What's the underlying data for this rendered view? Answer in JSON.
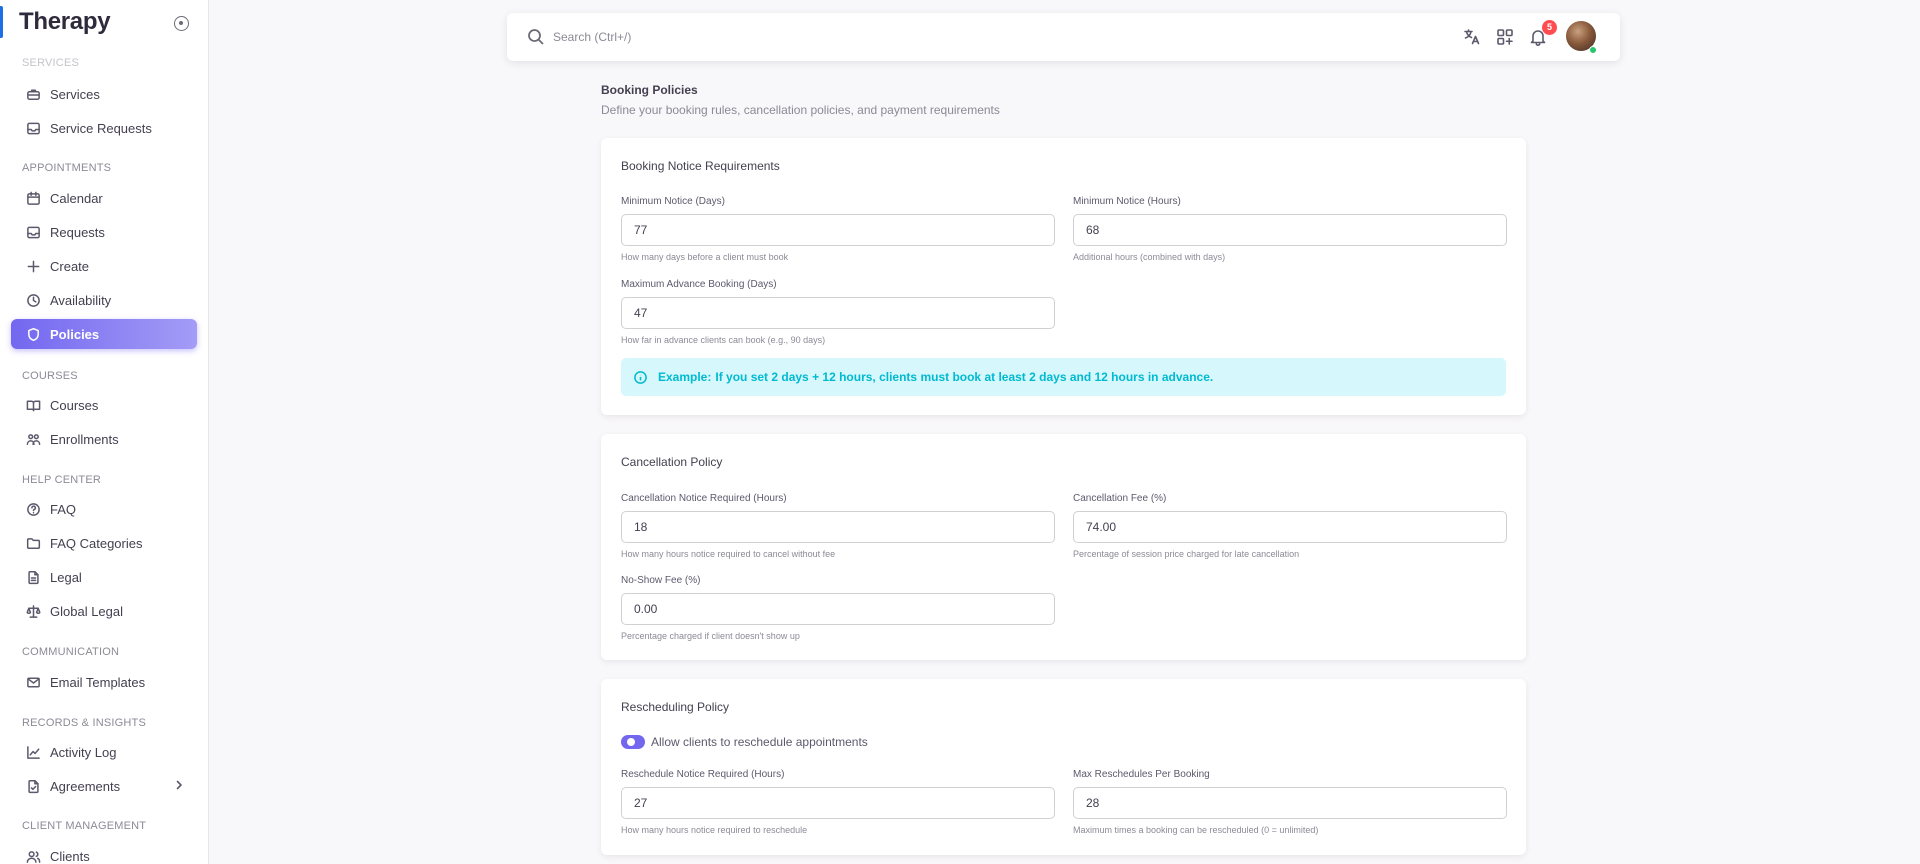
{
  "app": {
    "title": "Therapy"
  },
  "sidebar": {
    "sections": {
      "services": "SERVICES",
      "appointments": "APPOINTMENTS",
      "courses": "COURSES",
      "help_center": "HELP CENTER",
      "communication": "COMMUNICATION",
      "records": "RECORDS & INSIGHTS",
      "client_management": "CLIENT MANAGEMENT"
    },
    "items": {
      "services": "Services",
      "service_requests": "Service Requests",
      "calendar": "Calendar",
      "requests": "Requests",
      "create": "Create",
      "availability": "Availability",
      "policies": "Policies",
      "courses": "Courses",
      "enrollments": "Enrollments",
      "faq": "FAQ",
      "faq_categories": "FAQ Categories",
      "legal": "Legal",
      "global_legal": "Global Legal",
      "email_templates": "Email Templates",
      "activity_log": "Activity Log",
      "agreements": "Agreements",
      "clients": "Clients"
    },
    "active": "policies"
  },
  "topbar": {
    "search_placeholder": "Search (Ctrl+/)",
    "notifications_count": "5",
    "icons": [
      "translate-icon",
      "apps-grid-icon",
      "bell-icon"
    ]
  },
  "page": {
    "title": "Booking Policies",
    "subtitle": "Define your booking rules, cancellation policies, and payment requirements"
  },
  "booking_notice": {
    "title": "Booking Notice Requirements",
    "min_days_label": "Minimum Notice (Days)",
    "min_days_value": "77",
    "min_days_help": "How many days before a client must book",
    "min_hours_label": "Minimum Notice (Hours)",
    "min_hours_value": "68",
    "min_hours_help": "Additional hours (combined with days)",
    "max_advance_label": "Maximum Advance Booking (Days)",
    "max_advance_value": "47",
    "max_advance_help": "How far in advance clients can book (e.g., 90 days)",
    "example_label": "Example:",
    "example_text": "If you set 2 days + 12 hours, clients must book at least 2 days and 12 hours in advance."
  },
  "cancellation": {
    "title": "Cancellation Policy",
    "notice_label": "Cancellation Notice Required (Hours)",
    "notice_value": "18",
    "notice_help": "How many hours notice required to cancel without fee",
    "fee_label": "Cancellation Fee (%)",
    "fee_value": "74.00",
    "fee_help": "Percentage of session price charged for late cancellation",
    "noshow_label": "No-Show Fee (%)",
    "noshow_value": "0.00",
    "noshow_help": "Percentage charged if client doesn't show up"
  },
  "rescheduling": {
    "title": "Rescheduling Policy",
    "allow_label": "Allow clients to reschedule appointments",
    "allow_enabled": true,
    "notice_label": "Reschedule Notice Required (Hours)",
    "notice_value": "27",
    "notice_help": "How many hours notice required to reschedule",
    "max_label": "Max Reschedules Per Booking",
    "max_value": "28",
    "max_help": "Maximum times a booking can be rescheduled (0 = unlimited)"
  },
  "colors": {
    "primary": "#7367f0",
    "info": "#00bad1",
    "info_bg": "#d6f7fb",
    "badge": "#ff4c51",
    "online": "#28c76f"
  }
}
